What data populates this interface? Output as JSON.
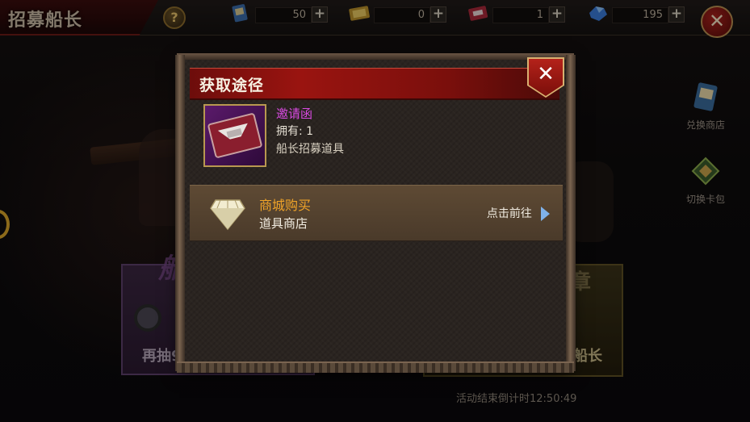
{
  "header": {
    "title": "招募船长",
    "help_label": "?"
  },
  "resources": [
    {
      "icon": "card-icon",
      "count": "50",
      "plus": "+"
    },
    {
      "icon": "gold-ticket-icon",
      "count": "0",
      "plus": "+"
    },
    {
      "icon": "invitation-icon",
      "count": "1",
      "plus": "+"
    },
    {
      "icon": "gem-icon",
      "count": "195",
      "plus": "+"
    }
  ],
  "close_label": "✕",
  "side": {
    "exchange_shop": "兑换商店",
    "switch_pack": "切换卡包"
  },
  "background": {
    "left_card_label": "再抽9",
    "left_card_big": "船",
    "right_card_label": "船长",
    "right_card_big": "章",
    "countdown": "活动结束倒计时12:50:49"
  },
  "dialog": {
    "title": "获取途径",
    "close_label": "✕",
    "item": {
      "name": "邀请函",
      "own_label": "拥有:",
      "own_value": "1",
      "description": "船长招募道具"
    },
    "sources": [
      {
        "title": "商城购买",
        "subtitle": "道具商店",
        "action": "点击前往"
      }
    ]
  },
  "colors": {
    "item_name": "#d84ae0",
    "source_title": "#f0a428",
    "header_red": "#9a1410"
  }
}
